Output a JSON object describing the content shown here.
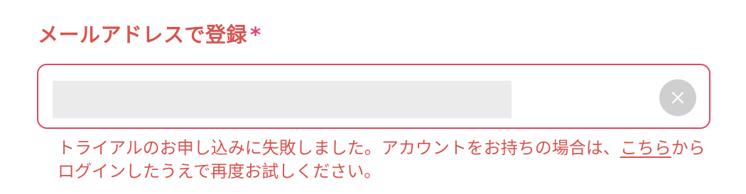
{
  "email_field": {
    "label": "メールアドレスで登録",
    "required_mark": "*",
    "value": ""
  },
  "error": {
    "text_before_link": "トライアルのお申し込みに失敗しました。アカウントをお持ちの場合は、",
    "link_label": "こちら",
    "text_after_link": "からログインしたうえで再度お試しください。"
  },
  "icons": {
    "clear": "close-icon"
  },
  "colors": {
    "label": "#d9534f",
    "required_mark": "#e0457b",
    "input_border": "#e0475f",
    "input_fill": "#ebebeb",
    "clear_button": "#cfcfcf",
    "error_text": "#d9534f"
  }
}
